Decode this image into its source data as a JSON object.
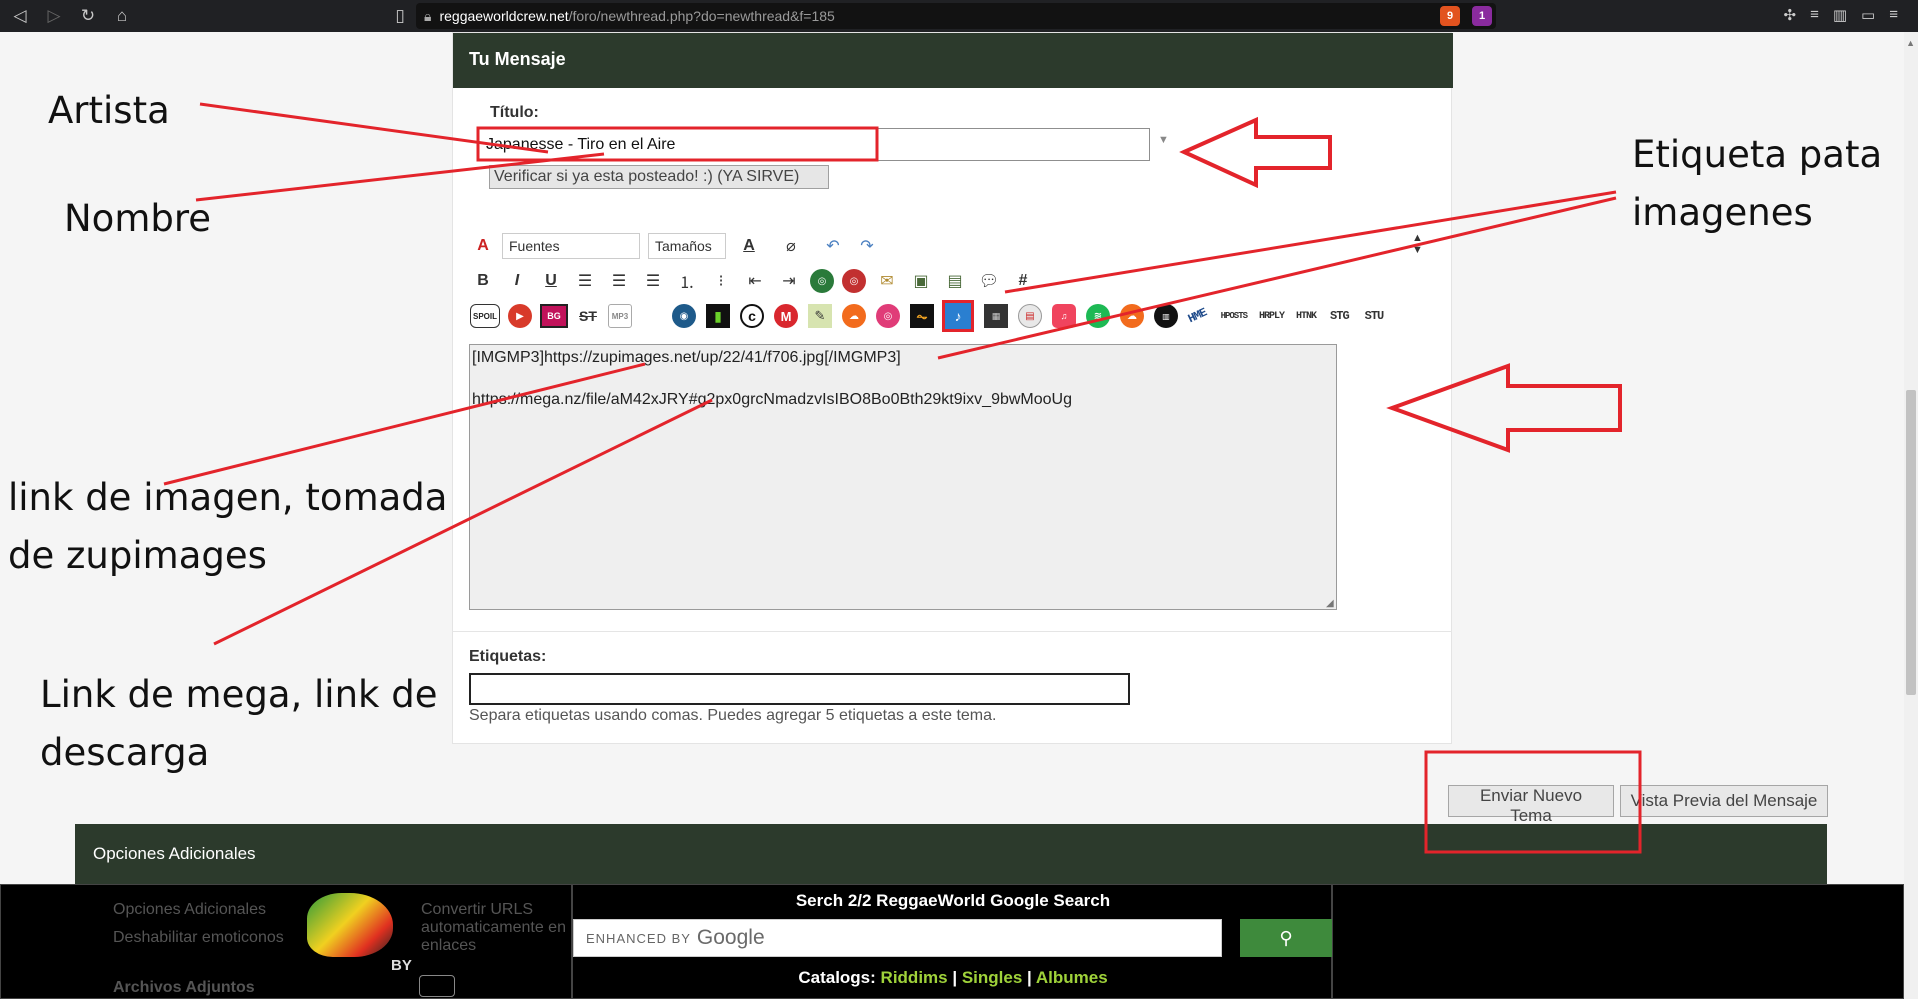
{
  "browser": {
    "url_host": "reggaeworldcrew.net",
    "url_path": "/foro/newthread.php?do=newthread&f=185",
    "shield_badge": "9",
    "alert_badge": "1"
  },
  "form": {
    "header": "Tu Mensaje",
    "title_label": "Título:",
    "title_value": "Japanesse - Tiro en el Aire",
    "verify_button": "Verificar si ya esta posteado! :) (YA SIRVE)",
    "fonts_select": "Fuentes",
    "sizes_select": "Tamaños",
    "message_text": "[IMGMP3]https://zupimages.net/up/22/41/f706.jpg[/IMGMP3]\n\nhttps://mega.nz/file/aM42xJRY#g2px0grcNmadzvIsIBO8Bo0Bth29kt9ixv_9bwMooUg",
    "tags_label": "Etiquetas:",
    "tags_help": "Separa etiquetas usando comas. Puedes agregar 5 etiquetas a este tema.",
    "submit_button": "Enviar Nuevo Tema",
    "preview_button": "Vista Previa del Mensaje"
  },
  "toolbar_icons": {
    "bold": "B",
    "italic": "I",
    "underline": "U",
    "hash": "#",
    "spoil": "SPOIL",
    "bg": "BG",
    "st": "ST",
    "mp3": "MP3",
    "hme": "HME",
    "hposts": "HPOSTS",
    "hrply": "HRPLY",
    "htnk": "HTNK",
    "stg": "STG",
    "stu": "STU"
  },
  "options_bar": {
    "title": "Opciones Adicionales"
  },
  "footer": {
    "search_title": "Serch 2/2 ReggaeWorld Google Search",
    "enhanced_by": "ENHANCED BY",
    "google": "Google",
    "catalogs_label": "Catalogs:",
    "catalog_links": [
      "Riddims",
      "Singles",
      "Albumes"
    ],
    "by_text": "BY",
    "ghost_opts": "Opciones Adicionales",
    "ghost_convert": "Convertir URLS automaticamente en enlaces",
    "ghost_emoticons": "Deshabilitar emoticonos",
    "ghost_attach": "Archivos Adjuntos"
  },
  "annotations": {
    "artista": "Artista",
    "nombre": "Nombre",
    "etiqueta_line1": "Etiqueta pata",
    "etiqueta_line2": "imagenes",
    "link_imagen_line1": "link de imagen, tomada",
    "link_imagen_line2": "de zupimages",
    "link_mega_line1": "Link de mega, link de",
    "link_mega_line2": "descarga"
  },
  "colors": {
    "panel_header": "#2c3a2c",
    "annotation_red": "#e3242b",
    "catalog_link": "#9fd23a",
    "search_button": "#3e8a3c"
  }
}
